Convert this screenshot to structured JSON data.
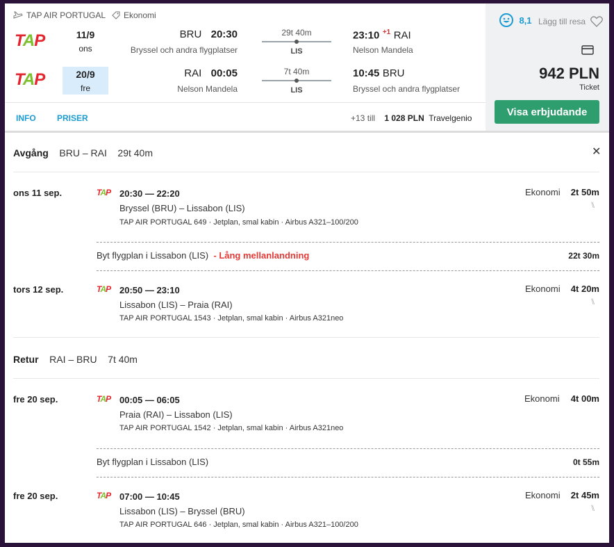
{
  "header": {
    "airline": "TAP AIR PORTUGAL",
    "cabin": "Ekonomi",
    "rating": "8,1",
    "add_trip": "Lägg till resa",
    "price": "942 PLN",
    "price_type": "Ticket",
    "cta": "Visa erbjudande",
    "tab_info": "INFO",
    "tab_prices": "PRISER",
    "more_offers": "+13 till",
    "alt_price": "1 028 PLN",
    "alt_provider": "Travelgenio"
  },
  "outbound_summary": {
    "date": "11/9",
    "weekday": "ons",
    "from_code": "BRU",
    "dep_time": "20:30",
    "from_name": "Bryssel och andra flygplatser",
    "duration": "29t 40m",
    "stop": "LIS",
    "arr_time": "23:10",
    "day_offset": "+1",
    "to_code": "RAI",
    "to_name": "Nelson Mandela"
  },
  "return_summary": {
    "date": "20/9",
    "weekday": "fre",
    "from_code": "RAI",
    "dep_time": "00:05",
    "from_name": "Nelson Mandela",
    "duration": "7t 40m",
    "stop": "LIS",
    "arr_time": "10:45",
    "to_code": "BRU",
    "to_name": "Bryssel och andra flygplatser"
  },
  "details": {
    "outbound": {
      "label": "Avgång",
      "route": "BRU – RAI",
      "duration": "29t 40m",
      "seg1": {
        "date": "ons 11 sep.",
        "times": "20:30 — 22:20",
        "route": "Bryssel (BRU) – Lissabon (LIS)",
        "info": "TAP AIR PORTUGAL 649 · Jetplan, smal kabin · Airbus A321–100/200",
        "cabin": "Ekonomi",
        "duration": "2t 50m"
      },
      "layover": {
        "text": "Byt flygplan i Lissabon (LIS)",
        "warning": "- Lång mellanlandning",
        "duration": "22t 30m"
      },
      "seg2": {
        "date": "tors 12 sep.",
        "times": "20:50 — 23:10",
        "route": "Lissabon (LIS) – Praia (RAI)",
        "info": "TAP AIR PORTUGAL 1543 · Jetplan, smal kabin · Airbus A321neo",
        "cabin": "Ekonomi",
        "duration": "4t 20m"
      }
    },
    "return": {
      "label": "Retur",
      "route": "RAI – BRU",
      "duration": "7t 40m",
      "seg1": {
        "date": "fre 20 sep.",
        "times": "00:05 — 06:05",
        "route": "Praia (RAI) – Lissabon (LIS)",
        "info": "TAP AIR PORTUGAL 1542 · Jetplan, smal kabin · Airbus A321neo",
        "cabin": "Ekonomi",
        "duration": "4t 00m"
      },
      "layover": {
        "text": "Byt flygplan i Lissabon (LIS)",
        "duration": "0t 55m"
      },
      "seg2": {
        "date": "fre 20 sep.",
        "times": "07:00 — 10:45",
        "route": "Lissabon (LIS) – Bryssel (BRU)",
        "info": "TAP AIR PORTUGAL 646 · Jetplan, smal kabin · Airbus A321–100/200",
        "cabin": "Ekonomi",
        "duration": "2t 45m"
      }
    }
  },
  "logo_text": {
    "t": "T",
    "a": "A",
    "p": "P"
  },
  "colors": {
    "accent": "#1b9bd3",
    "cta": "#2e9e6e",
    "warning": "#e53935",
    "logo_red": "#e3262d",
    "logo_green": "#7bbf2a"
  }
}
